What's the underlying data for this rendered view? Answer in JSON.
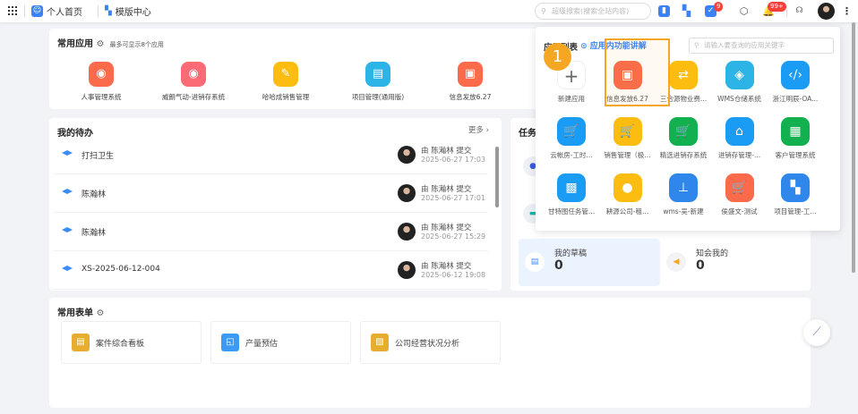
{
  "topbar": {
    "home_label": "个人首页",
    "template_label": "模版中心",
    "search_placeholder": "超级搜索(搜索全站内容)",
    "task_badge": "9",
    "notify_badge": "99+"
  },
  "common_apps": {
    "title": "常用应用",
    "hint": "最多可显示8个应用",
    "items": [
      {
        "label": "人事管理系统",
        "color": "#fa6a4b",
        "icon": "globe-icon"
      },
      {
        "label": "威朗气动-进销存系统",
        "color": "#fb6b76",
        "icon": "globe-icon"
      },
      {
        "label": "哈哈成销售管理",
        "color": "#fcbd10",
        "icon": "pencil-icon"
      },
      {
        "label": "项目管理(通用版)",
        "color": "#2cb4e6",
        "icon": "server-icon"
      },
      {
        "label": "信息发放6.27",
        "color": "#fa6a4b",
        "icon": "board-icon"
      }
    ]
  },
  "todo": {
    "title": "我的待办",
    "more": "更多",
    "items": [
      {
        "title": "打扫卫生",
        "by": "由 陈瀚林 提交",
        "time": "2025-06-27 17:03"
      },
      {
        "title": "陈瀚林",
        "by": "由 陈瀚林 提交",
        "time": "2025-06-27 17:01"
      },
      {
        "title": "陈瀚林",
        "by": "由 陈瀚林 提交",
        "time": "2025-06-27 15:29"
      },
      {
        "title": "XS-2025-06-12-004",
        "by": "由 陈瀚林 提交",
        "time": "2025-06-12 19:08"
      }
    ]
  },
  "tasks": {
    "title": "任务",
    "draft_label": "我的草稿",
    "draft_count": "0",
    "cc_label": "知会我的",
    "cc_count": "0"
  },
  "forms": {
    "title": "常用表单",
    "items": [
      {
        "label": "案件综合看板",
        "color": "#e6ad2e"
      },
      {
        "label": "产量预估",
        "color": "#3b9af5"
      },
      {
        "label": "公司经营状况分析",
        "color": "#e6ad2e"
      }
    ]
  },
  "popup": {
    "title": "应用列表",
    "guide_link": "应用内功能讲解",
    "search_placeholder": "请输入要查询的应用关键字",
    "step_number": "1",
    "highlight_color": "#f5a623",
    "apps": [
      {
        "label": "新建应用",
        "color": "#ffffff",
        "icon": "plus-icon"
      },
      {
        "label": "信息发放6.27",
        "color": "#fa6a4b",
        "icon": "board-icon"
      },
      {
        "label": "三合源物业费...",
        "color": "#fcbd10",
        "icon": "swap-icon"
      },
      {
        "label": "WMS仓储系统",
        "color": "#2cb4e6",
        "icon": "graduation-cap-icon"
      },
      {
        "label": "浙江明辰-OA...",
        "color": "#1a9cf5",
        "icon": "code-window-icon"
      },
      {
        "label": "云帐房-工时...",
        "color": "#1a9cf5",
        "icon": "cart-icon"
      },
      {
        "label": "销售管理（极...",
        "color": "#fcbd10",
        "icon": "cart-icon"
      },
      {
        "label": "精选进销存系统",
        "color": "#13b04f",
        "icon": "cart-icon"
      },
      {
        "label": "进销存管理-...",
        "color": "#1a9cf5",
        "icon": "house-icon"
      },
      {
        "label": "客户管理系统",
        "color": "#13b04f",
        "icon": "presentation-icon"
      },
      {
        "label": "甘特图任务管...",
        "color": "#1a9cf5",
        "icon": "gift-icon"
      },
      {
        "label": "耕源公司-租...",
        "color": "#fcbd10",
        "icon": "bulb-icon"
      },
      {
        "label": "wms-吴-新建",
        "color": "#2f86eb",
        "icon": "crane-icon"
      },
      {
        "label": "侯盛文-测试",
        "color": "#fa6a4b",
        "icon": "cart-icon"
      },
      {
        "label": "项目管理-工...",
        "color": "#2f86eb",
        "icon": "widgets-icon"
      }
    ]
  }
}
